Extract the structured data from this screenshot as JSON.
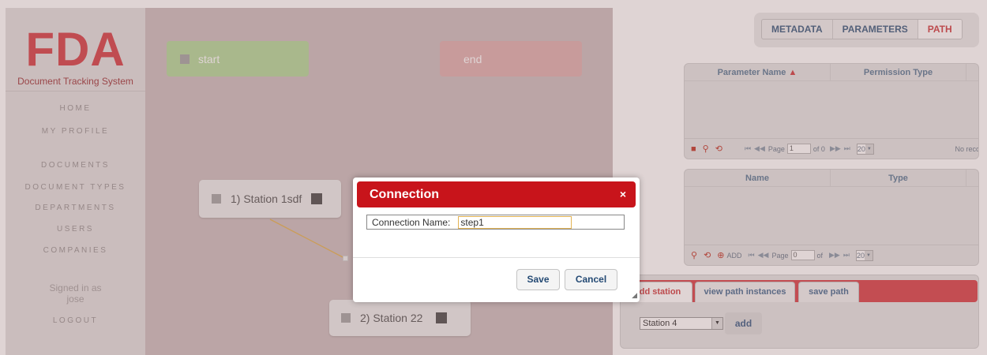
{
  "sidebar": {
    "logo": "FDA",
    "subtitle": "Document Tracking System",
    "nav": [
      {
        "label": "HOME"
      },
      {
        "label": "MY PROFILE"
      },
      {
        "label": "DOCUMENTS"
      },
      {
        "label": "DOCUMENT TYPES"
      },
      {
        "label": "DEPARTMENTS"
      },
      {
        "label": "USERS"
      },
      {
        "label": "COMPANIES"
      }
    ],
    "signed_in_line1": "Signed in as",
    "signed_in_user": "jose",
    "logout": "LOGOUT"
  },
  "canvas": {
    "start_label": "start",
    "end_label": "end",
    "stations": [
      {
        "label": "1) Station 1sdf"
      },
      {
        "label": "2) Station 22"
      }
    ]
  },
  "top_tabs": [
    {
      "label": "METADATA",
      "active": false
    },
    {
      "label": "PARAMETERS",
      "active": false
    },
    {
      "label": "PATH",
      "active": true
    }
  ],
  "param_grid": {
    "columns": [
      "Parameter Name",
      "Permission Type"
    ],
    "sort_icon": "sort-asc-icon",
    "pager": {
      "page_label": "Page",
      "page_value": "1",
      "of_label": "of 0",
      "page_size": "20",
      "status": "No reco"
    }
  },
  "station_grid": {
    "columns": [
      "Name",
      "Type"
    ],
    "pager": {
      "add_label": "ADD",
      "page_label": "Page",
      "page_value": "0",
      "of_label": "of",
      "page_size": "20"
    }
  },
  "bottom_panel": {
    "tabs": [
      {
        "label": "dd station",
        "active": true
      },
      {
        "label": "view path instances",
        "active": false
      },
      {
        "label": "save path",
        "active": false
      }
    ],
    "station_select": "Station 4",
    "add_button": "add"
  },
  "dialog": {
    "title": "Connection",
    "close": "×",
    "field_label": "Connection Name:",
    "field_value": "step1",
    "save": "Save",
    "cancel": "Cancel"
  },
  "colors": {
    "brand_red": "#d5434a",
    "dialog_header": "#c8141b",
    "start_node": "#b4d89c",
    "end_node": "#e0b0b1",
    "connection_line": "#e3b353"
  }
}
